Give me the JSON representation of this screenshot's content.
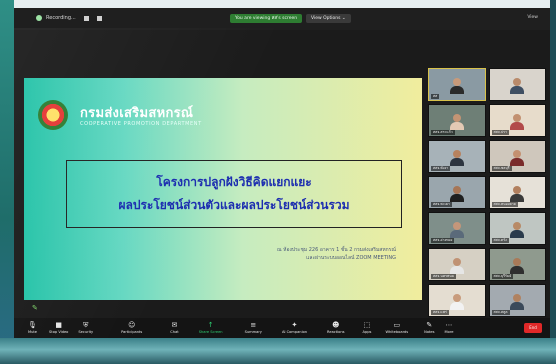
{
  "topbar": {
    "recording_label": "Recording...",
    "sharing_label": "You are viewing สส's screen",
    "view_options_label": "View Options ⌄",
    "view_label": "View"
  },
  "slide": {
    "dept_th": "กรมส่งเสริมสหกรณ์",
    "dept_en": "COOPERATIVE PROMOTION DEPARTMENT",
    "title_line1": "โครงการปลูกฝังวิธีคิดแยกแยะ",
    "title_line2": "ผลประโยชน์ส่วนตัวและผลประโยชน์ส่วนรวม",
    "venue_line1": "ณ ห้องประชุม 226 อาคาร 1 ชั้น 2 กรมส่งเสริมสหกรณ์",
    "venue_line2": "และผ่านระบบออนไลน์ ZOOM MEETING"
  },
  "gallery": {
    "tiles": [
      {
        "name": "สส",
        "bg": "#8a9aa3",
        "skin": "#c89a7a",
        "shirt": "#2b2b2b",
        "active": true
      },
      {
        "name": "",
        "bg": "#d9d4cc",
        "skin": "#b98a6a",
        "shirt": "#3f4f63",
        "active": false
      },
      {
        "name": "สสจ.สระแก้ว",
        "bg": "#6e7f76",
        "skin": "#c49474",
        "shirt": "#e3c9b4",
        "active": false
      },
      {
        "name": "สสจ.ปรา",
        "bg": "#e7dccb",
        "skin": "#c29070",
        "shirt": "#b24a4a",
        "active": false
      },
      {
        "name": "สสจ.พังงา",
        "bg": "#a7b2b8",
        "skin": "#b7825e",
        "shirt": "#2d3540",
        "active": false
      },
      {
        "name": "สสจ.ชลบุรี",
        "bg": "#cfc7bc",
        "skin": "#c49070",
        "shirt": "#7a2b2b",
        "active": false
      },
      {
        "name": "สสจ.พะเยา",
        "bg": "#9aa6ad",
        "skin": "#a77656",
        "shirt": "#1f1f1f",
        "active": false
      },
      {
        "name": "สสจ.หนองคาย",
        "bg": "#e6e1d8",
        "skin": "#b2805f",
        "shirt": "#3a3a3a",
        "active": false
      },
      {
        "name": "สสจ.อ่างทอง",
        "bg": "#7f8f8a",
        "skin": "#c4967a",
        "shirt": "#5a6a7a",
        "active": false
      },
      {
        "name": "สสจ.ตรัง",
        "bg": "#bfc6c2",
        "skin": "#b88a66",
        "shirt": "#2a3b4c",
        "active": false
      },
      {
        "name": "สสจ.นครพนม",
        "bg": "#d6d0c4",
        "skin": "#c09274",
        "shirt": "#e6e6e6",
        "active": false
      },
      {
        "name": "สสจ.บุรีรัมย์",
        "bg": "#8f9a8e",
        "skin": "#a97a58",
        "shirt": "#2f2f2f",
        "active": false
      },
      {
        "name": "สสจ.แพร่",
        "bg": "#e4ddd1",
        "skin": "#c89b7c",
        "shirt": "#f2f2f2",
        "active": false
      },
      {
        "name": "สสจ.สตูล",
        "bg": "#a3aab0",
        "skin": "#b08260",
        "shirt": "#3b4a5a",
        "active": false
      }
    ]
  },
  "toolbar": {
    "items": [
      {
        "name": "mute",
        "icon": "🎙",
        "label": "Mute"
      },
      {
        "name": "stop-video",
        "icon": "■",
        "label": "Stop Video"
      },
      {
        "name": "security",
        "icon": "⛨",
        "label": "Security"
      },
      {
        "name": "participants",
        "icon": "☺",
        "label": "Participants"
      },
      {
        "name": "chat",
        "icon": "✉",
        "label": "Chat"
      },
      {
        "name": "share-screen",
        "icon": "↑",
        "label": "Share Screen"
      },
      {
        "name": "summary",
        "icon": "≡",
        "label": "Summary"
      },
      {
        "name": "ai-companion",
        "icon": "✦",
        "label": "AI Companion"
      },
      {
        "name": "reactions",
        "icon": "☻",
        "label": "Reactions"
      },
      {
        "name": "apps",
        "icon": "⬚",
        "label": "Apps"
      },
      {
        "name": "whiteboards",
        "icon": "▭",
        "label": "Whiteboards"
      },
      {
        "name": "notes",
        "icon": "✎",
        "label": "Notes"
      },
      {
        "name": "more",
        "icon": "⋯",
        "label": "More"
      }
    ],
    "end_label": "End"
  },
  "colors": {
    "share_green": "#2ecc71",
    "end_red": "#e02828",
    "title_blue": "#1c2db0"
  }
}
